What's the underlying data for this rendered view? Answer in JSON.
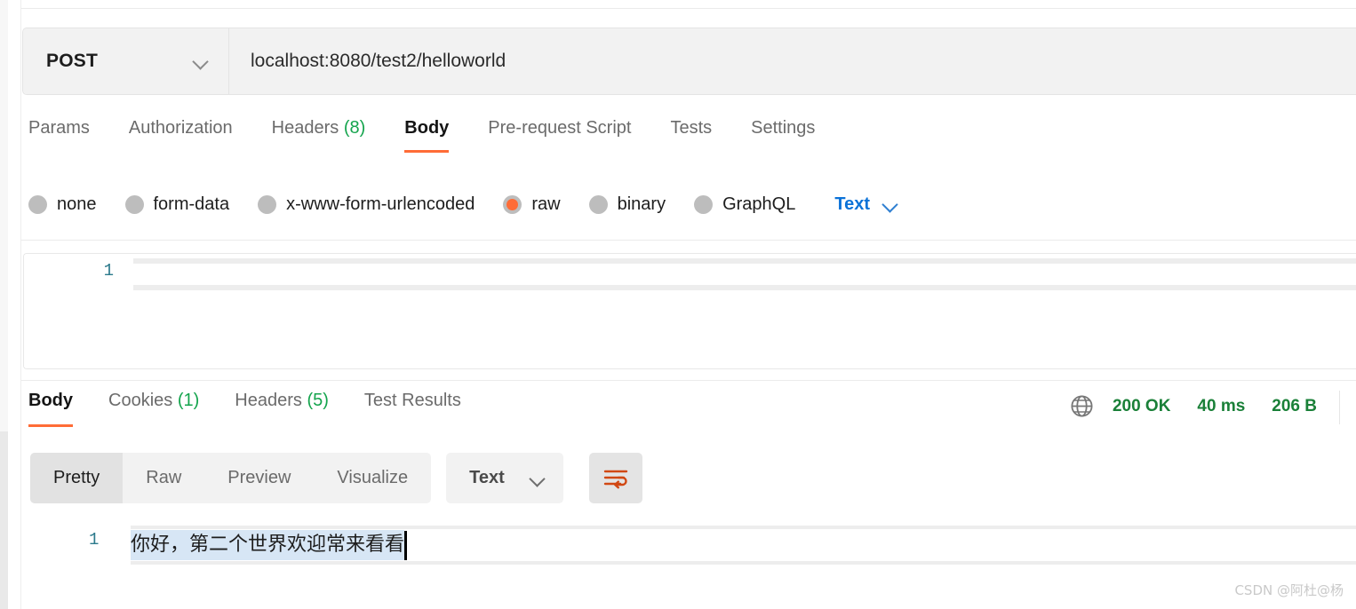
{
  "request": {
    "method": "POST",
    "method_chevron_icon": "chevron-down-icon",
    "url": "localhost:8080/test2/helloworld",
    "tabs": [
      {
        "label": "Params",
        "count": "",
        "active": false
      },
      {
        "label": "Authorization",
        "count": "",
        "active": false
      },
      {
        "label": "Headers",
        "count": "(8)",
        "active": false
      },
      {
        "label": "Body",
        "count": "",
        "active": true
      },
      {
        "label": "Pre-request Script",
        "count": "",
        "active": false
      },
      {
        "label": "Tests",
        "count": "",
        "active": false
      },
      {
        "label": "Settings",
        "count": "",
        "active": false
      }
    ],
    "body_types": [
      {
        "label": "none",
        "selected": false
      },
      {
        "label": "form-data",
        "selected": false
      },
      {
        "label": "x-www-form-urlencoded",
        "selected": false
      },
      {
        "label": "raw",
        "selected": true
      },
      {
        "label": "binary",
        "selected": false
      },
      {
        "label": "GraphQL",
        "selected": false
      }
    ],
    "raw_format": "Text",
    "raw_format_chevron_icon": "chevron-down-icon",
    "editor": {
      "line_number": "1",
      "content": ""
    }
  },
  "response": {
    "tabs": [
      {
        "label": "Body",
        "count": "",
        "active": true
      },
      {
        "label": "Cookies",
        "count": "(1)",
        "active": false
      },
      {
        "label": "Headers",
        "count": "(5)",
        "active": false
      },
      {
        "label": "Test Results",
        "count": "",
        "active": false
      }
    ],
    "status": {
      "globe_icon": "globe-icon",
      "code": "200 OK",
      "time": "40 ms",
      "size": "206 B",
      "color": "#1a8038"
    },
    "view_modes": [
      {
        "label": "Pretty",
        "active": true
      },
      {
        "label": "Raw",
        "active": false
      },
      {
        "label": "Preview",
        "active": false
      },
      {
        "label": "Visualize",
        "active": false
      }
    ],
    "format": "Text",
    "format_chevron_icon": "chevron-down-icon",
    "wrap_button_icon": "wrap-lines-icon",
    "body": {
      "line_number": "1",
      "text": "你好，第二个世界欢迎常来看看"
    }
  },
  "watermark": "CSDN @阿杜@杨",
  "colors": {
    "accent": "#ff6c37",
    "success": "#14a44d",
    "link": "#0b72d8",
    "selection": "#d7e6f5"
  }
}
